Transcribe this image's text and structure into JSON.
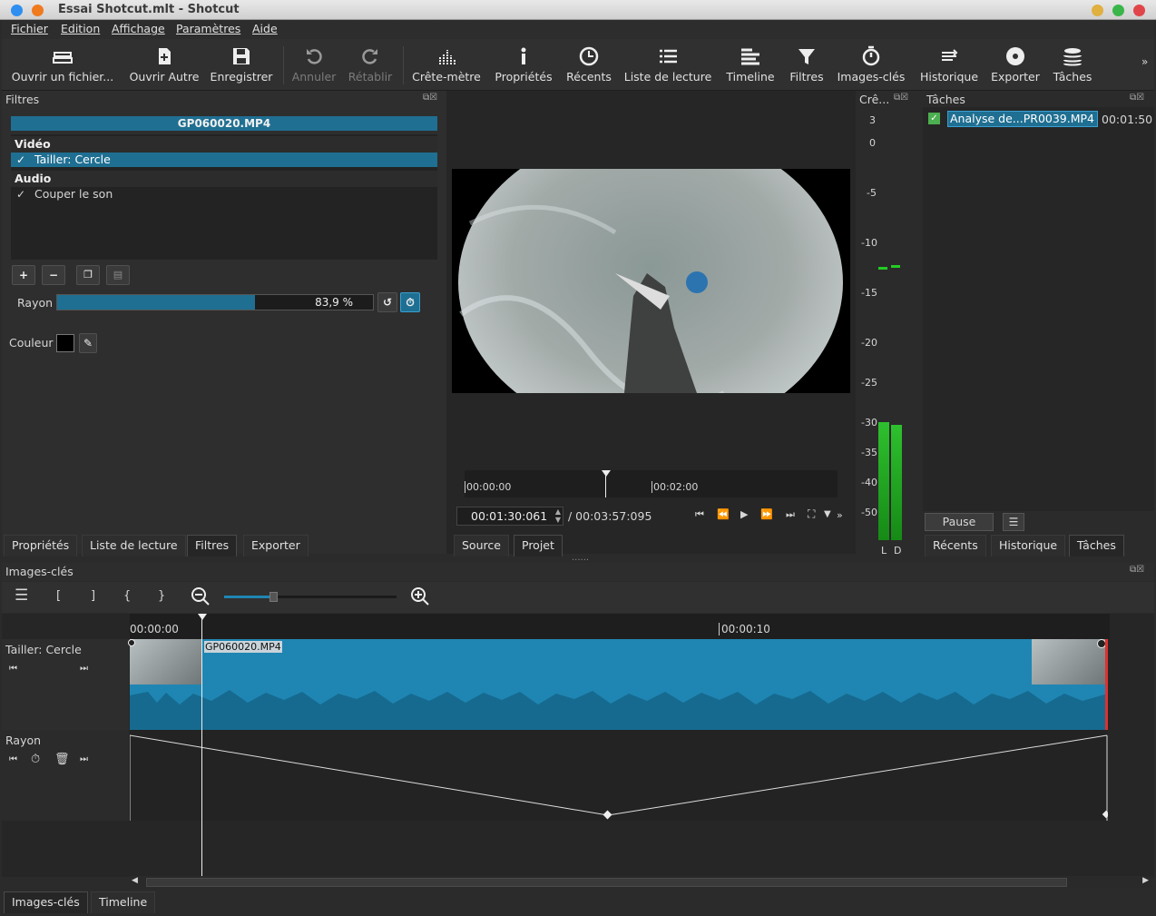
{
  "window": {
    "title": "Essai Shotcut.mlt - Shotcut"
  },
  "menu": [
    "Fichier",
    "Edition",
    "Affichage",
    "Paramètres",
    "Aide"
  ],
  "toolbar": {
    "open": "Ouvrir un fichier...",
    "open_other": "Ouvrir Autre",
    "save": "Enregistrer",
    "undo": "Annuler",
    "redo": "Rétablir",
    "peak": "Crête-mètre",
    "props": "Propriétés",
    "recent": "Récents",
    "playlist": "Liste de lecture",
    "timeline": "Timeline",
    "filters": "Filtres",
    "keyframes": "Images-clés",
    "history": "Historique",
    "export": "Exporter",
    "jobs": "Tâches",
    "more": "»"
  },
  "filters_panel": {
    "title": "Filtres",
    "clip": "GP060020.MP4",
    "video_group": "Vidéo",
    "video_items": [
      {
        "label": "Tailler: Cercle",
        "checked": "✓"
      }
    ],
    "audio_group": "Audio",
    "audio_items": [
      {
        "label": "Couper le son",
        "checked": "✓"
      }
    ],
    "radius_label": "Rayon",
    "radius_value": "83,9 %",
    "radius_fraction": 0.839,
    "color_label": "Couleur",
    "color_value": "#000000"
  },
  "player": {
    "timecode": "00:01:30:061",
    "duration": "/ 00:03:57:095",
    "ruler": [
      "00:00:00",
      "00:02:00"
    ],
    "tabs": [
      "Source",
      "Projet"
    ]
  },
  "meter": {
    "title": "Crê...",
    "scale": [
      "3",
      "0",
      "-5",
      "-10",
      "-15",
      "-20",
      "-25",
      "-30",
      "-35",
      "-40",
      "-50"
    ],
    "channels": [
      "L",
      "D"
    ]
  },
  "jobs_panel": {
    "title": "Tâches",
    "job_name": "Analyse de...PR0039.MP4",
    "job_time": "00:01:50",
    "pause": "Pause",
    "tabs": [
      "Récents",
      "Historique",
      "Tâches"
    ]
  },
  "left_tabs": [
    "Propriétés",
    "Liste de lecture",
    "Filtres",
    "Exporter"
  ],
  "keyframes": {
    "title": "Images-clés",
    "tool_glyphs": [
      "[",
      "]",
      "{",
      "}"
    ],
    "ruler": [
      "00:00:00",
      "00:00:10"
    ],
    "track1_label": "Tailler: Cercle",
    "clip_label": "GP060020.MP4",
    "track2_label": "Rayon"
  },
  "bottom_tabs": [
    "Images-clés",
    "Timeline"
  ],
  "colors": {
    "accent": "#1f86b3",
    "selection": "#1f6f92",
    "meter_green": "#22aa22"
  }
}
